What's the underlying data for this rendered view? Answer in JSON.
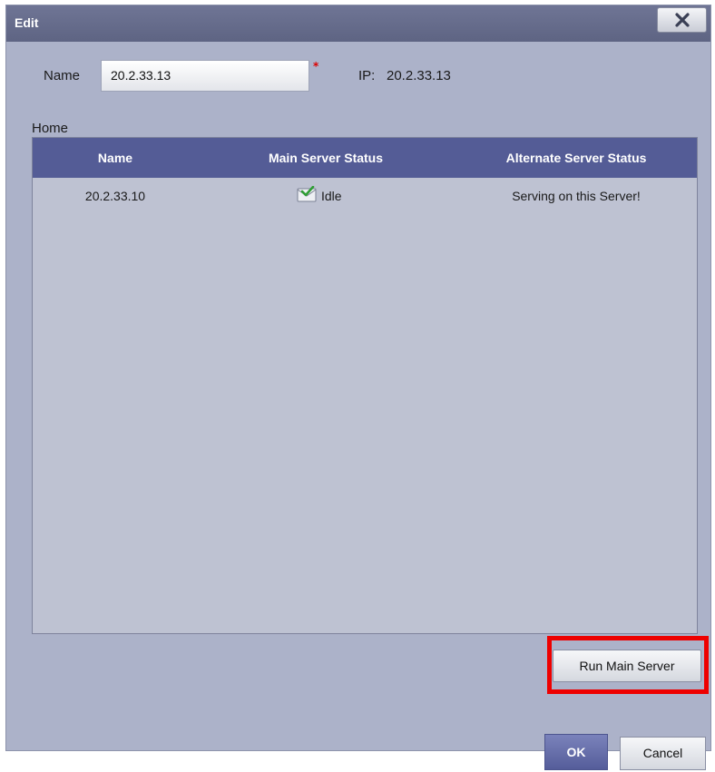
{
  "window": {
    "title": "Edit"
  },
  "form": {
    "name_label": "Name",
    "name_value": "20.2.33.13",
    "required_marker": "*",
    "ip_label": "IP:",
    "ip_value": "20.2.33.13"
  },
  "section": {
    "label": "Home"
  },
  "table": {
    "headers": [
      "Name",
      "Main Server Status",
      "Alternate Server Status"
    ],
    "rows": [
      {
        "name": "20.2.33.10",
        "main_status": "Idle",
        "main_status_icon": "idle-status-icon",
        "alternate_status": "Serving on this Server!"
      }
    ]
  },
  "actions": {
    "run_main_server": "Run Main Server",
    "ok": "OK",
    "cancel": "Cancel"
  },
  "colors": {
    "dialog_bg": "#acb2c9",
    "header_bg": "#545c96",
    "highlight": "#ee0000",
    "required": "#dd0000"
  }
}
